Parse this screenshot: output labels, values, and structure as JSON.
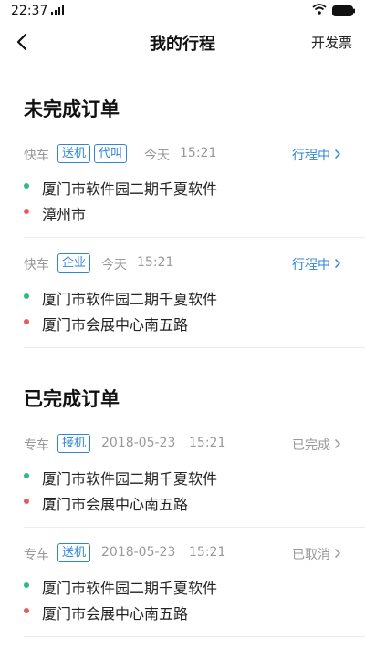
{
  "status_bar": {
    "time": "22:37"
  },
  "header": {
    "title": "我的行程",
    "right_action": "开发票"
  },
  "sections": {
    "pending_title": "未完成订单",
    "completed_title": "已完成订单"
  },
  "orders": [
    {
      "category": "快车",
      "tags": [
        "送机",
        "代叫"
      ],
      "date": "今天",
      "time": "15:21",
      "status": "行程中",
      "from": "厦门市软件园二期千夏软件",
      "to": "漳州市"
    },
    {
      "category": "快车",
      "tags": [
        "企业"
      ],
      "date": "今天",
      "time": "15:21",
      "status": "行程中",
      "from": "厦门市软件园二期千夏软件",
      "to": "厦门市会展中心南五路"
    },
    {
      "category": "专车",
      "tags": [
        "接机"
      ],
      "date": "2018-05-23",
      "time": "15:21",
      "status": "已完成",
      "from": "厦门市软件园二期千夏软件",
      "to": "厦门市会展中心南五路"
    },
    {
      "category": "专车",
      "tags": [
        "送机"
      ],
      "date": "2018-05-23",
      "time": "15:21",
      "status": "已取消",
      "from": "厦门市软件园二期千夏软件",
      "to": "厦门市会展中心南五路"
    }
  ],
  "colors": {
    "accent": "#2f86d8",
    "start_dot": "#2dbb7f",
    "end_dot": "#e85a5a",
    "muted": "#999999"
  }
}
